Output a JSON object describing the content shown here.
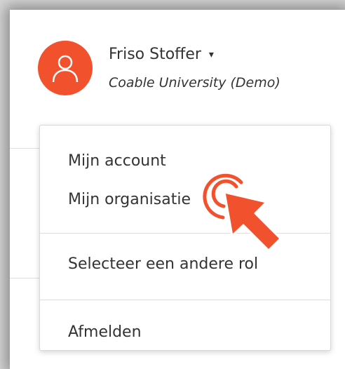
{
  "user": {
    "name": "Friso Stoffer",
    "caret": "▾",
    "organization": "Coable University (Demo)",
    "avatar_icon": "user-icon",
    "avatar_color": "#f2512d"
  },
  "menu": {
    "items": [
      {
        "label": "Mijn account"
      },
      {
        "label": "Mijn organisatie"
      },
      {
        "label": "Selecteer een andere rol"
      },
      {
        "label": "Afmelden"
      }
    ]
  },
  "click_indicator": {
    "icon": "click-pointer-icon",
    "color": "#f2512d"
  }
}
